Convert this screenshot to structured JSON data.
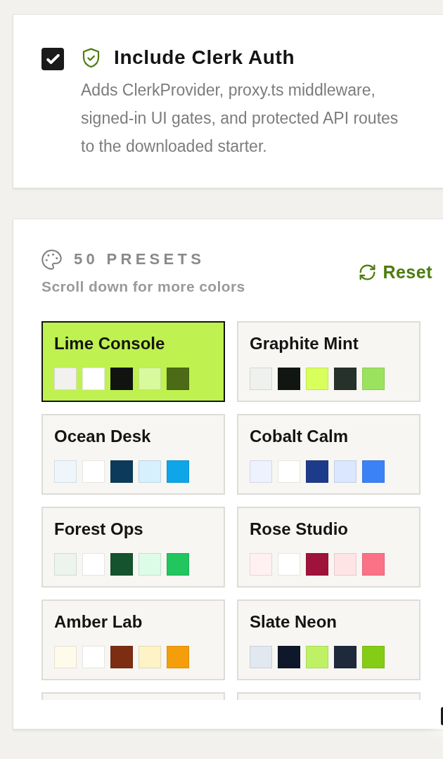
{
  "auth_option": {
    "checked": true,
    "title": "Include Clerk Auth",
    "description": "Adds ClerkProvider, proxy.ts middleware, signed-in UI gates, and protected API routes to the downloaded starter."
  },
  "presets": {
    "heading": "50 PRESETS",
    "hint": "Scroll down for more colors",
    "reset_label": "Reset",
    "items": [
      {
        "name": "Lime Console",
        "selected": true,
        "swatches": [
          {
            "color": "#f2f1ed"
          },
          {
            "color": "#ffffff"
          },
          {
            "color": "#111311"
          },
          {
            "color": "#d9f99d"
          },
          {
            "color": "#4d6b16"
          }
        ]
      },
      {
        "name": "Graphite Mint",
        "selected": false,
        "swatches": [
          {
            "color": "#eef1ee"
          },
          {
            "color": "#121613"
          },
          {
            "color": "#d9ff5c"
          },
          {
            "color": "#27312b"
          },
          {
            "color": "#9be25f"
          }
        ]
      },
      {
        "name": "Ocean Desk",
        "selected": false,
        "swatches": [
          {
            "color": "#eef6fb"
          },
          {
            "color": "#ffffff"
          },
          {
            "color": "#0c3a5a"
          },
          {
            "color": "#d6f0fd"
          },
          {
            "color": "#0ea5e9"
          }
        ]
      },
      {
        "name": "Cobalt Calm",
        "selected": false,
        "swatches": [
          {
            "color": "#eef2ff"
          },
          {
            "color": "#ffffff"
          },
          {
            "color": "#1e3a8a"
          },
          {
            "color": "#dbe7fe"
          },
          {
            "color": "#3b82f6"
          }
        ]
      },
      {
        "name": "Forest Ops",
        "selected": false,
        "swatches": [
          {
            "color": "#edf4ee"
          },
          {
            "color": "#ffffff"
          },
          {
            "color": "#14532d"
          },
          {
            "color": "#dcfce7"
          },
          {
            "color": "#22c55e"
          }
        ]
      },
      {
        "name": "Rose Studio",
        "selected": false,
        "swatches": [
          {
            "color": "#fff1f2"
          },
          {
            "color": "#ffffff"
          },
          {
            "color": "#9f1239"
          },
          {
            "color": "#ffe4e6"
          },
          {
            "color": "#fb7185"
          }
        ]
      },
      {
        "name": "Amber Lab",
        "selected": false,
        "swatches": [
          {
            "color": "#fffbeb"
          },
          {
            "color": "#ffffff"
          },
          {
            "color": "#7c2d12"
          },
          {
            "color": "#fef3c7"
          },
          {
            "color": "#f59e0b"
          }
        ]
      },
      {
        "name": "Slate Neon",
        "selected": false,
        "swatches": [
          {
            "color": "#e2e8f0"
          },
          {
            "color": "#0f172a"
          },
          {
            "color": "#bef264"
          },
          {
            "color": "#1e293b"
          },
          {
            "color": "#84cc16"
          }
        ]
      },
      {
        "selected": false
      },
      {
        "selected": false
      }
    ]
  }
}
